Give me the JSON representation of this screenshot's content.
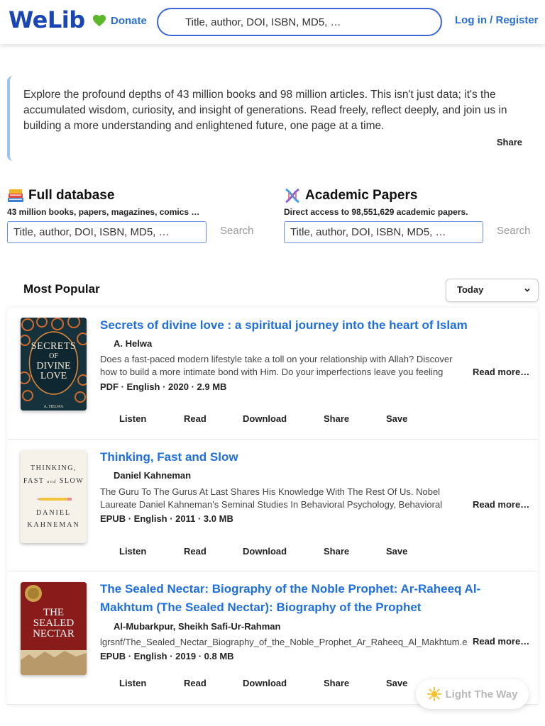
{
  "header": {
    "logo": "WeLib",
    "donate_label": "Donate",
    "search_placeholder": "Title, author, DOI, ISBN, MD5, …",
    "login_label": "Log in / Register"
  },
  "intro": {
    "text": "Explore the profound depths of 43 million books and 98 million articles. This isn't just data; it's the accumulated wisdom, curiosity, and insight of generations. Read freely, reflect deeply, and join us in building a more understanding and enlightened future, one page at a time.",
    "share_label": "Share"
  },
  "full_database": {
    "icon": "books-icon",
    "title": "Full database",
    "subtitle": "43 million books, papers, magazines, comics …",
    "placeholder": "Title, author, DOI, ISBN, MD5, …",
    "search_label": "Search"
  },
  "academic_papers": {
    "icon": "dna-icon",
    "title": "Academic Papers",
    "subtitle": "Direct access to 98,551,629 academic papers.",
    "placeholder": "Title, author, DOI, ISBN, MD5, …",
    "search_label": "Search"
  },
  "popular": {
    "title": "Most Popular",
    "period": "Today"
  },
  "actions": {
    "listen": "Listen",
    "read": "Read",
    "download": "Download",
    "share": "Share",
    "save": "Save",
    "read_more": "Read more…"
  },
  "books": [
    {
      "title": "Secrets of divine love : a spiritual journey into the heart of Islam",
      "author": "A. Helwa",
      "description": "Does a fast-paced modern lifestyle take a toll on your relationship with Allah? Discover how to build a more intimate bond with Him. Do your imperfections leave you feeling unworthy of lo",
      "meta": "PDF · English · 2020 · 2.9 MB",
      "cover": {
        "line1": "SECRETS",
        "line2": "OF",
        "line3": "DIVINE",
        "line4": "LOVE",
        "author": "A. HELWA"
      }
    },
    {
      "title": "Thinking, Fast and Slow",
      "author": "Daniel Kahneman",
      "description": "The Guru To The Gurus At Last Shares His Knowledge With The Rest Of Us. Nobel Laureate Daniel Kahneman's Seminal Studies In Behavioral Psychology, Behavioral Economics, And Hap",
      "meta": "EPUB · English · 2011 · 3.0 MB",
      "cover": {
        "line1": "THINKING,",
        "line2": "FAST",
        "line2b": "and",
        "line2c": "SLOW",
        "line3": "DANIEL",
        "line4": "KAHNEMAN"
      }
    },
    {
      "title": "The Sealed Nectar: Biography of the Noble Prophet: Ar-Raheeq Al-Makhtum (The Sealed Nectar): Biography of the Prophet",
      "author": "Al-Mubarkpur, Sheikh Safi-Ur-Rahman",
      "description": "lgrsnf/The_Sealed_Nectar_Biography_of_the_Noble_Prophet_Ar_Raheeq_Al_Makhtum.e",
      "meta": "EPUB · English · 2019 · 0.8 MB",
      "cover": {
        "line1": "THE",
        "line2": "SEALED",
        "line3": "NECTAR"
      }
    }
  ],
  "floating": {
    "label": "Light The Way",
    "icon": "sun-icon"
  },
  "colors": {
    "brand": "#1a46b4",
    "link": "#1f6fe0",
    "accent_border": "#9cc2f0"
  }
}
